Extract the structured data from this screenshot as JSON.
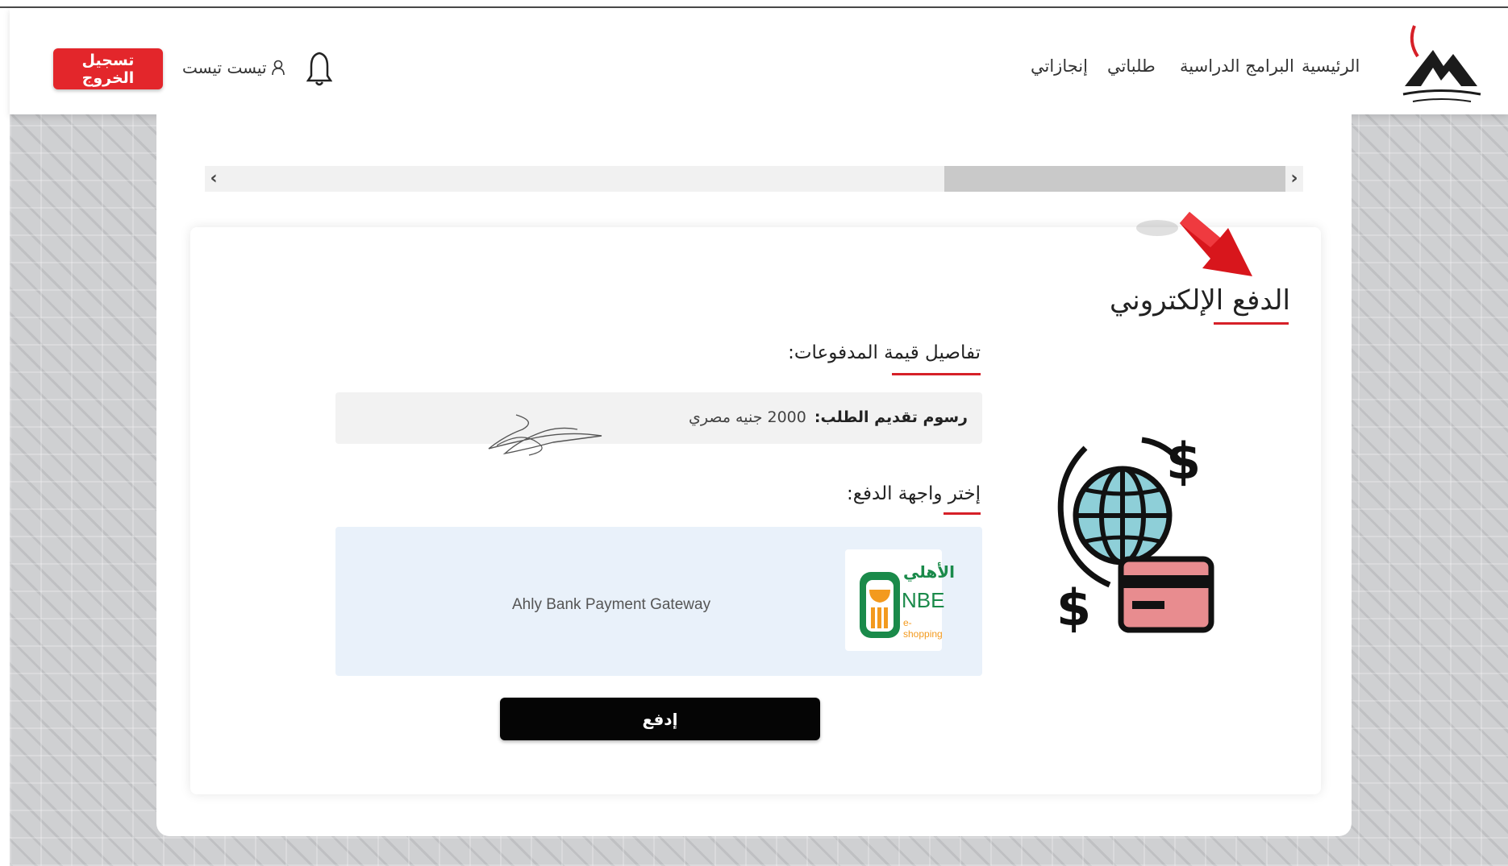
{
  "nav": {
    "links": [
      "الرئيسية",
      "البرامج الدراسية",
      "طلباتي",
      "إنجازاتي"
    ],
    "user_name": "تيست تيست",
    "logout_label": "تسجيل الخروج"
  },
  "payment": {
    "title": "الدفع الإلكتروني",
    "details_heading": "تفاصيل قيمة المدفوعات:",
    "fee_label": "رسوم تقديم الطلب:",
    "fee_value": "2000 جنيه مصري",
    "gateway_heading": "إختر واجهة الدفع:",
    "gateway_name": "Ahly Bank Payment Gateway",
    "gateway_logo": {
      "arabic": "الأهلي",
      "text": "NBE",
      "subtext": "e-shopping"
    },
    "pay_label": "إدفع"
  },
  "icons": {
    "bell": "bell-icon",
    "user": "user-icon",
    "payment": "globe-card-payment-icon",
    "arrow": "red-arrow-icon"
  },
  "colors": {
    "accent_red": "#e3262b",
    "pay_button": "#050505",
    "gateway_bg": "#e9f1fa",
    "nbe_green": "#1a8a4a",
    "nbe_orange": "#f39a1e"
  }
}
